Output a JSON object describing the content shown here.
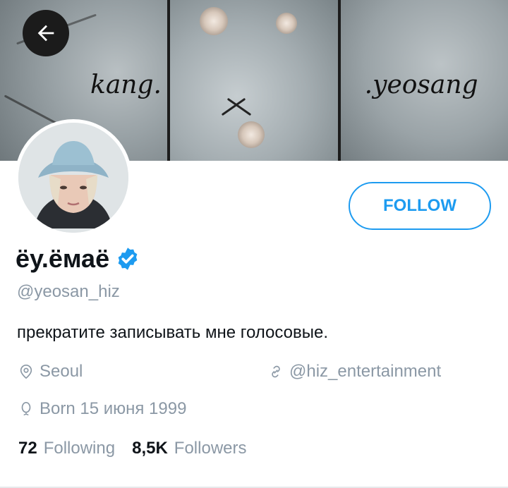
{
  "banner": {
    "left_text": "kang.",
    "right_text": ".yeosang"
  },
  "actions": {
    "follow_label": "FOLLOW"
  },
  "profile": {
    "name": "ёу.ёмаё",
    "handle": "@yeosan_hiz",
    "bio": "прекратите записывать мне голосовые.",
    "location": "Seoul",
    "website": "@hiz_entertainment",
    "born": "Born 15 июня 1999"
  },
  "stats": {
    "following_count": "72",
    "following_label": "Following",
    "followers_count": "8,5K",
    "followers_label": "Followers"
  },
  "colors": {
    "accent": "#1d9bf0",
    "muted": "#8b98a5",
    "text": "#0f1419"
  },
  "icons": [
    "back-arrow-icon",
    "verified-badge-icon",
    "location-pin-icon",
    "link-icon",
    "balloon-icon"
  ]
}
